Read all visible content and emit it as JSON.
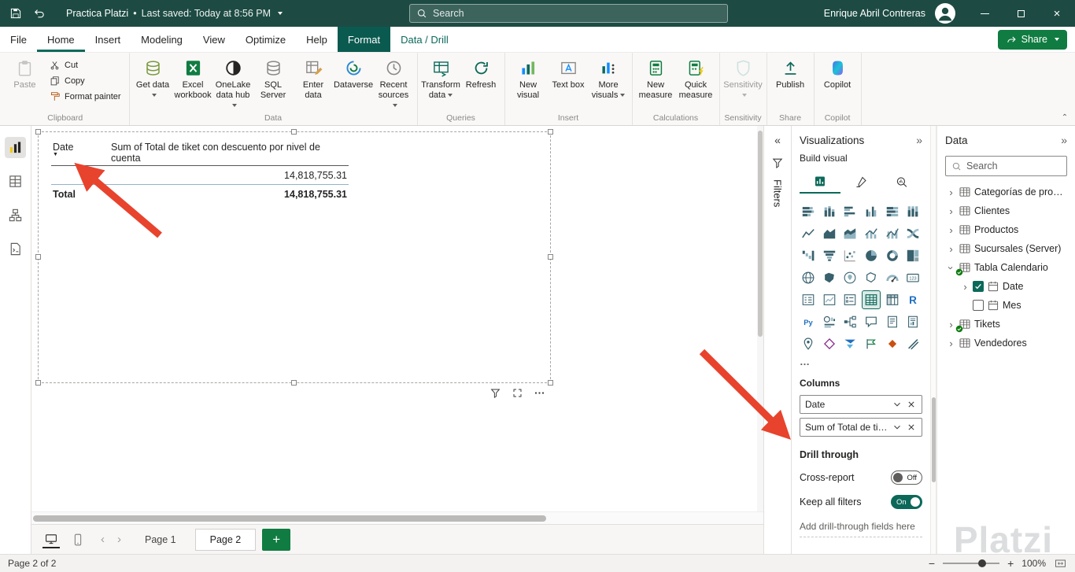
{
  "titlebar": {
    "title": "Practica Platzi",
    "separator": "•",
    "saved_status": "Last saved: Today at 8:56 PM",
    "search_placeholder": "Search",
    "user_name": "Enrique Abril Contreras"
  },
  "menubar": {
    "items": [
      {
        "label": "File",
        "state": "normal"
      },
      {
        "label": "Home",
        "state": "active"
      },
      {
        "label": "Insert",
        "state": "normal"
      },
      {
        "label": "Modeling",
        "state": "normal"
      },
      {
        "label": "View",
        "state": "normal"
      },
      {
        "label": "Optimize",
        "state": "normal"
      },
      {
        "label": "Help",
        "state": "normal"
      },
      {
        "label": "Format",
        "state": "contextual-selected"
      },
      {
        "label": "Data / Drill",
        "state": "contextual"
      }
    ],
    "share_label": "Share"
  },
  "ribbon": {
    "groups": [
      {
        "label": "Clipboard",
        "items": [
          {
            "label": "Paste",
            "icon": "paste",
            "size": "large",
            "disabled": true
          },
          {
            "label": "Cut",
            "icon": "cut",
            "size": "small"
          },
          {
            "label": "Copy",
            "icon": "copy",
            "size": "small"
          },
          {
            "label": "Format painter",
            "icon": "format-painter",
            "size": "small"
          }
        ]
      },
      {
        "label": "Data",
        "items": [
          {
            "label": "Get data",
            "icon": "get-data",
            "size": "large",
            "caret": true
          },
          {
            "label": "Excel workbook",
            "icon": "excel-workbook",
            "size": "large"
          },
          {
            "label": "OneLake data hub",
            "icon": "onelake-data-hub",
            "size": "large",
            "caret": true
          },
          {
            "label": "SQL Server",
            "icon": "sql-server",
            "size": "large"
          },
          {
            "label": "Enter data",
            "icon": "enter-data",
            "size": "large"
          },
          {
            "label": "Dataverse",
            "icon": "dataverse",
            "size": "large"
          },
          {
            "label": "Recent sources",
            "icon": "recent-sources",
            "size": "large",
            "caret": true
          }
        ]
      },
      {
        "label": "Queries",
        "items": [
          {
            "label": "Transform data",
            "icon": "transform-data",
            "size": "large",
            "caret": true
          },
          {
            "label": "Refresh",
            "icon": "refresh",
            "size": "large"
          }
        ]
      },
      {
        "label": "Insert",
        "items": [
          {
            "label": "New visual",
            "icon": "new-visual",
            "size": "large"
          },
          {
            "label": "Text box",
            "icon": "text-box",
            "size": "large"
          },
          {
            "label": "More visuals",
            "icon": "more-visuals",
            "size": "large",
            "caret": true
          }
        ]
      },
      {
        "label": "Calculations",
        "items": [
          {
            "label": "New measure",
            "icon": "new-measure",
            "size": "large"
          },
          {
            "label": "Quick measure",
            "icon": "quick-measure",
            "size": "large"
          }
        ]
      },
      {
        "label": "Sensitivity",
        "items": [
          {
            "label": "Sensitivity",
            "icon": "sensitivity",
            "size": "large",
            "disabled": true,
            "caret": true
          }
        ]
      },
      {
        "label": "Share",
        "items": [
          {
            "label": "Publish",
            "icon": "publish",
            "size": "large"
          }
        ]
      },
      {
        "label": "Copilot",
        "items": [
          {
            "label": "Copilot",
            "icon": "copilot",
            "size": "large"
          }
        ]
      }
    ]
  },
  "leftnav": {
    "items": [
      {
        "name": "report-view",
        "selected": true
      },
      {
        "name": "table-view",
        "selected": false
      },
      {
        "name": "model-view",
        "selected": false
      },
      {
        "name": "dax-query-view",
        "selected": false
      }
    ]
  },
  "canvas": {
    "visual": {
      "type": "table",
      "columns": [
        "Date",
        "Sum of Total de tiket con descuento por nivel de cuenta"
      ],
      "rows": [
        [
          "",
          "14,818,755.31"
        ]
      ],
      "total_label": "Total",
      "total_value": "14,818,755.31"
    }
  },
  "filters_panel": {
    "title": "Filters"
  },
  "viz_panel": {
    "title": "Visualizations",
    "build_label": "Build visual",
    "tabs": [
      "build-visual",
      "format-visual",
      "analytics"
    ],
    "selected_tab": "build-visual",
    "visual_types": [
      "stacked-bar-chart",
      "stacked-column-chart",
      "clustered-bar-chart",
      "clustered-column-chart",
      "100-stacked-bar-chart",
      "100-stacked-column-chart",
      "line-chart",
      "area-chart",
      "stacked-area-chart",
      "line-stacked-column-chart",
      "line-clustered-column-chart",
      "ribbon-chart",
      "waterfall-chart",
      "funnel-chart",
      "scatter-chart",
      "pie-chart",
      "donut-chart",
      "treemap",
      "map",
      "filled-map",
      "azure-map",
      "shape-map",
      "gauge",
      "card",
      "multi-row-card",
      "kpi",
      "slicer",
      "table",
      "matrix",
      "r-script",
      "python-visual",
      "key-influencers",
      "decomposition-tree",
      "qa-visual",
      "smart-narrative",
      "paginated-report",
      "arcgis-map",
      "power-apps",
      "power-automate",
      "metrics",
      "pinned-visual",
      "custom-visual"
    ],
    "selected_visual": "table",
    "more_label": "…",
    "columns_section": {
      "label": "Columns",
      "fields": [
        "Date",
        "Sum of Total de tiket ..."
      ]
    },
    "drill_through": {
      "label": "Drill through",
      "rows": [
        {
          "label": "Cross-report",
          "state": "Off"
        },
        {
          "label": "Keep all filters",
          "state": "On"
        }
      ],
      "hint": "Add drill-through fields here"
    }
  },
  "data_panel": {
    "title": "Data",
    "search_placeholder": "Search",
    "tree": [
      {
        "label": "Categorías de product...",
        "icon": "table",
        "expandable": true
      },
      {
        "label": "Clientes",
        "icon": "table",
        "expandable": true
      },
      {
        "label": "Productos",
        "icon": "table",
        "expandable": true
      },
      {
        "label": "Sucursales (Server)",
        "icon": "table",
        "expandable": true
      },
      {
        "label": "Tabla Calendario",
        "icon": "table",
        "checked_badge": true,
        "expandable": true,
        "expanded": true,
        "children": [
          {
            "label": "Date",
            "icon": "calendar",
            "checkbox": "checked",
            "expandable": true
          },
          {
            "label": "Mes",
            "icon": "calendar",
            "checkbox": "unchecked"
          }
        ]
      },
      {
        "label": "Tikets",
        "icon": "table",
        "checked_badge": true,
        "expandable": true
      },
      {
        "label": "Vendedores",
        "icon": "table",
        "expandable": true
      }
    ]
  },
  "pagebar": {
    "tabs": [
      {
        "label": "Page 1",
        "active": false
      },
      {
        "label": "Page 2",
        "active": true
      }
    ],
    "add_label": "+"
  },
  "statusbar": {
    "page_indicator": "Page 2 of 2",
    "zoom": "100%"
  },
  "watermark": "Platzi",
  "colors": {
    "accent_teal": "#0c695a",
    "titlebar_green": "#1d4b43",
    "share_green": "#107c41",
    "arrow_red": "#e8432d"
  }
}
